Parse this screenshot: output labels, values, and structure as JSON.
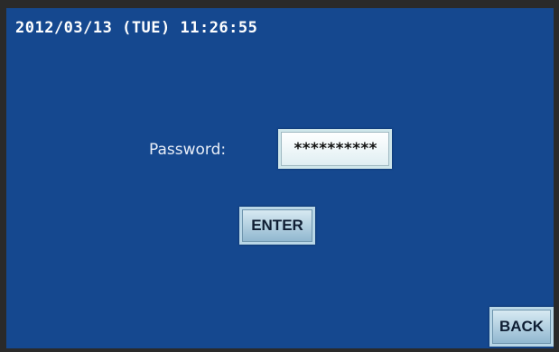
{
  "status_bar": {
    "datetime": "2012/03/13 (TUE) 11:26:55"
  },
  "login": {
    "password_label": "Password:",
    "password_value": "**********",
    "enter_label": "ENTER"
  },
  "footer": {
    "back_label": "BACK"
  },
  "colors": {
    "screen_background": "#15488f",
    "bezel": "#2a2a2a",
    "button_face": "#b9d7e7"
  }
}
